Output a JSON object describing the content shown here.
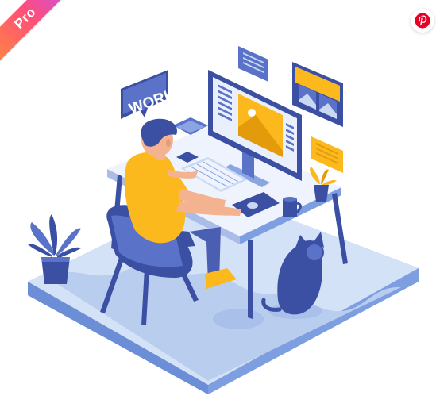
{
  "badge": {
    "label": "Pro",
    "colors": [
      "#ff8a3d",
      "#ff4f7a",
      "#c84cf0"
    ]
  },
  "share": {
    "icon": "pinterest-icon",
    "color": "#e60023"
  },
  "illustration": {
    "speech_bubble_text": "WORK",
    "palette": {
      "floor": "#c9d9f3",
      "floor_edge": "#7d9ee0",
      "blue_dark": "#3b4fa3",
      "blue_mid": "#5a73c9",
      "yellow": "#fcb91e",
      "skin": "#f3b391",
      "desk_top": "#eef3fd"
    }
  }
}
